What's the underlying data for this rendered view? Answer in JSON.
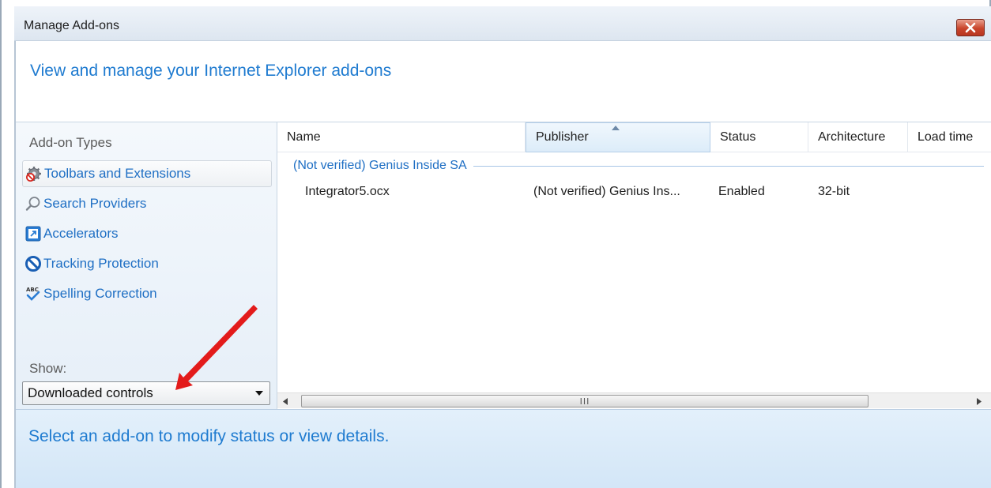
{
  "window": {
    "title": "Manage Add-ons",
    "close_icon": "close-x-icon"
  },
  "header": {
    "text": "View and manage your Internet Explorer add-ons"
  },
  "sidebar": {
    "heading": "Add-on Types",
    "items": [
      {
        "label": "Toolbars and Extensions",
        "icon": "gear-blocked-icon",
        "selected": true
      },
      {
        "label": "Search Providers",
        "icon": "magnifier-icon",
        "selected": false
      },
      {
        "label": "Accelerators",
        "icon": "accelerator-icon",
        "selected": false
      },
      {
        "label": "Tracking Protection",
        "icon": "no-entry-icon",
        "selected": false
      },
      {
        "label": "Spelling Correction",
        "icon": "abc-check-icon",
        "selected": false
      }
    ],
    "show_label": "Show:",
    "show_value": "Downloaded controls"
  },
  "list": {
    "columns": [
      "Name",
      "Publisher",
      "Status",
      "Architecture",
      "Load time"
    ],
    "sorted_column": "Publisher",
    "group": "(Not verified) Genius Inside SA",
    "rows": [
      {
        "name": "Integrator5.ocx",
        "publisher": "(Not verified) Genius Ins...",
        "status": "Enabled",
        "architecture": "32-bit",
        "load_time": ""
      }
    ],
    "scroll_grip": "III"
  },
  "details": {
    "text": "Select an add-on to modify status or view details."
  },
  "colors": {
    "accent_blue": "#1f7bd0",
    "link_blue": "#1f6fc4",
    "close_red": "#c9452c",
    "annotation_red": "#e31b1b"
  }
}
